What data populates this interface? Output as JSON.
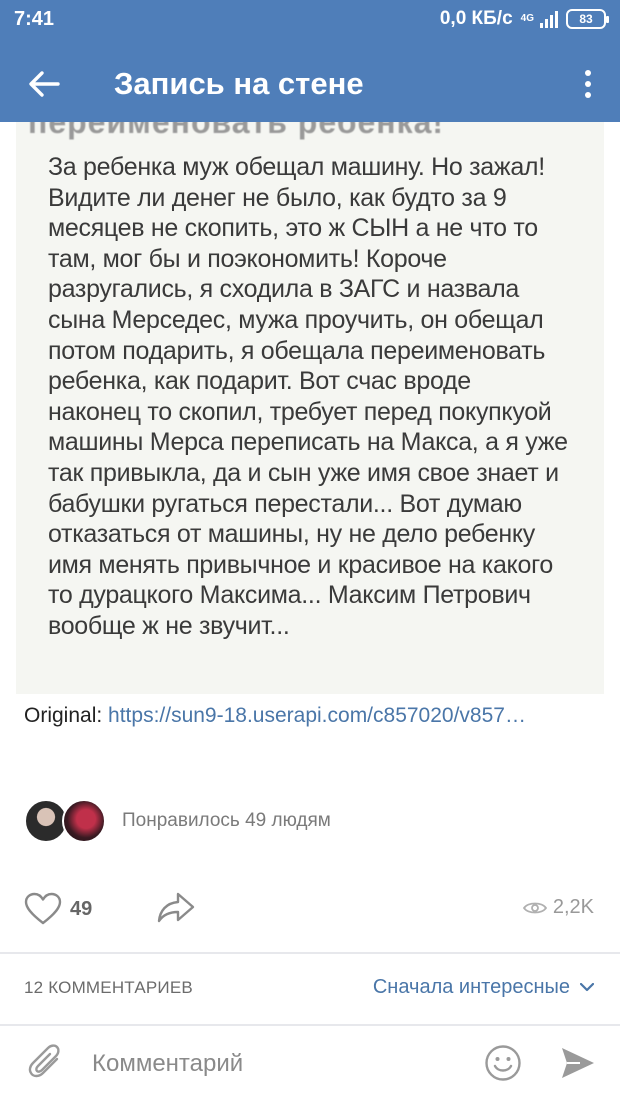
{
  "status_bar": {
    "time": "7:41",
    "speed": "0,0 КБ/с",
    "network": "4G",
    "battery": "83"
  },
  "header": {
    "title": "Запись на стене"
  },
  "post": {
    "cut_text": "переименовать ребенка!",
    "text": "За ребенка муж обещал машину. Но зажал!\nВидите ли денег не было, как будто за 9\nмесяцев не скопить, это ж СЫН а не что то\nтам, мог бы и поэкономить! Короче\nразругались, я сходила в ЗАГС и назвала\nсына Мерседес, мужа проучить, он обещал\nпотом подарить, я обещала переименовать\nребенка, как подарит. Вот счас вроде\nнаконец то скопил, требует перед покупкуой\nмашины Мерса переписать на Макса, а я уже\nтак привыкла, да и сын уже имя свое знает и\nбабушки ругаться перестали... Вот думаю\nотказаться от машины, ну не дело ребенку\nимя менять привычное и красивое на какого\nто дурацкого Максима... Максим Петрович\nвообще ж не звучит...",
    "original_label": "Original:",
    "original_link": "https://sun9-18.userapi.com/c857020/v857…"
  },
  "likes": {
    "liked_by_text": "Понравилось 49 людям",
    "count": "49"
  },
  "views": {
    "count": "2,2K"
  },
  "comments": {
    "count_label": "12 КОММЕНТАРИЕВ",
    "sort_label": "Сначала интересные"
  },
  "composer": {
    "placeholder": "Комментарий"
  },
  "colors": {
    "header_bg": "#4f7eb9",
    "link": "#4a76a8",
    "muted": "#7a7a7a"
  },
  "icons": [
    "back-arrow-icon",
    "more-vertical-icon",
    "heart-icon",
    "share-icon",
    "eye-icon",
    "chevron-down-icon",
    "paperclip-icon",
    "emoji-icon",
    "send-icon"
  ]
}
